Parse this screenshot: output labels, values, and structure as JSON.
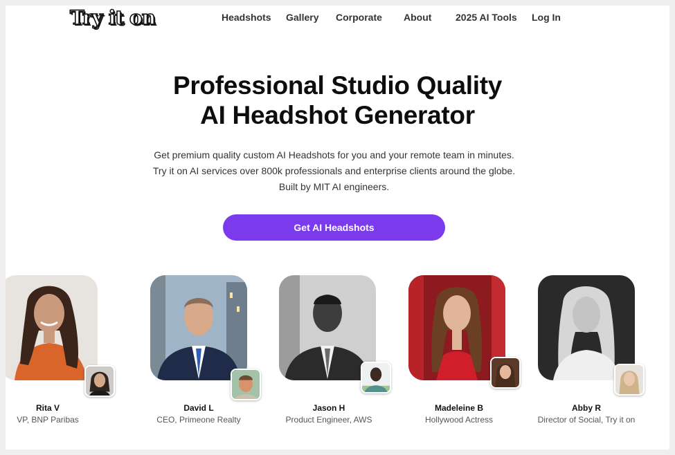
{
  "brand": {
    "logo_text": "Try it on"
  },
  "nav": {
    "items": [
      {
        "label": "Headshots"
      },
      {
        "label": "Gallery"
      },
      {
        "label": "Corporate"
      },
      {
        "label": "About"
      },
      {
        "label": "2025 AI Tools"
      },
      {
        "label": "Log In"
      }
    ]
  },
  "hero": {
    "title_line1": "Professional Studio Quality",
    "title_line2": "AI Headshot Generator",
    "subtitle": "Get premium quality custom AI Headshots for you and your remote team in minutes. Try it on AI services over 800k professionals and enterprise clients around the globe. Built by MIT AI engineers.",
    "cta_label": "Get AI Headshots"
  },
  "testimonials": [
    {
      "name": "Rita V",
      "role": "VP, BNP Paribas"
    },
    {
      "name": "David L",
      "role": "CEO, Primeone Realty"
    },
    {
      "name": "Jason H",
      "role": "Product Engineer, AWS"
    },
    {
      "name": "Madeleine B",
      "role": "Hollywood Actress"
    },
    {
      "name": "Abby R",
      "role": "Director of Social, Try it on"
    }
  ],
  "colors": {
    "accent": "#7c3aed",
    "background": "#ffffff",
    "frame": "#efefef"
  }
}
